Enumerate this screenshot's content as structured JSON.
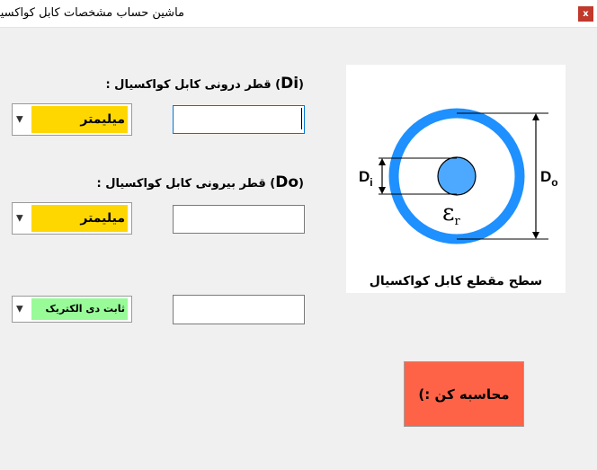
{
  "window": {
    "title": "ماشین حساب مشخصات کابل کواکسیال",
    "close_label": "x"
  },
  "inner_diameter": {
    "label_prefix": "(",
    "label_symbol": "Di",
    "label_text": ") قطر درونی کابل کواکسیال :",
    "unit": "میلیمتر",
    "value": ""
  },
  "outer_diameter": {
    "label_prefix": "(",
    "label_symbol": "Do",
    "label_text": ") قطر بیرونی کابل کواکسیال :",
    "unit": "میلیمتر",
    "value": ""
  },
  "dielectric": {
    "selected": "ثابت دی الکتریک",
    "value": ""
  },
  "diagram": {
    "di_label": "D",
    "di_sub": "i",
    "do_label": "D",
    "do_sub": "o",
    "er_label": "ε",
    "er_sub": "r",
    "caption": "سطح مقطع کابل کواکسیال"
  },
  "calculate_button": "محاسبه کن :)",
  "colors": {
    "unit_select_bg": "#ffd700",
    "dielectric_select_bg": "#98fb98",
    "button_bg": "#ff6347",
    "ring_blue": "#1e90ff",
    "core_blue": "#4da9ff"
  }
}
